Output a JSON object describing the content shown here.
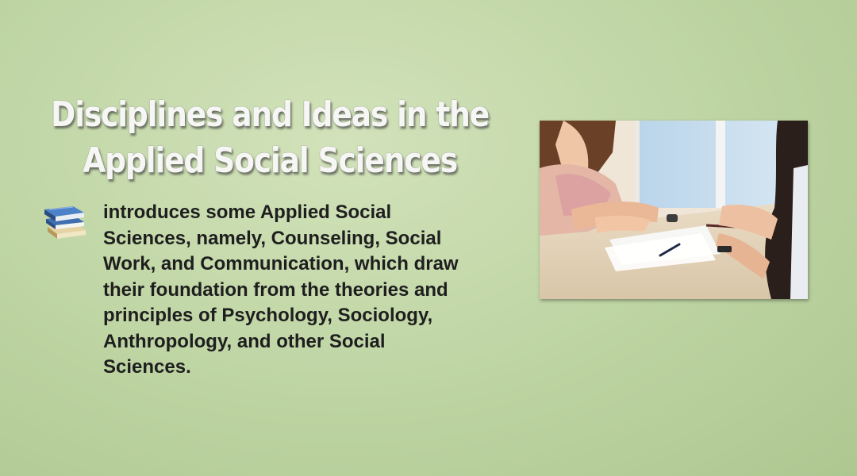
{
  "slide": {
    "title_line1": "Disciplines and Ideas in the",
    "title_line2": "Applied Social Sciences",
    "body_lines": [
      "introduces some Applied Social",
      "Sciences, namely, Counseling, Social",
      "Work, and Communication, which draw",
      "their foundation from the theories and",
      "principles of Psychology, Sociology,",
      "Anthropology, and other Social",
      "Sciences."
    ],
    "bullet_icon": "books-icon",
    "photo_icon": "counseling-photo"
  },
  "colors": {
    "background": "#bdd4a2",
    "title": "#f6f6f4",
    "body_text": "#1e1e1e"
  }
}
